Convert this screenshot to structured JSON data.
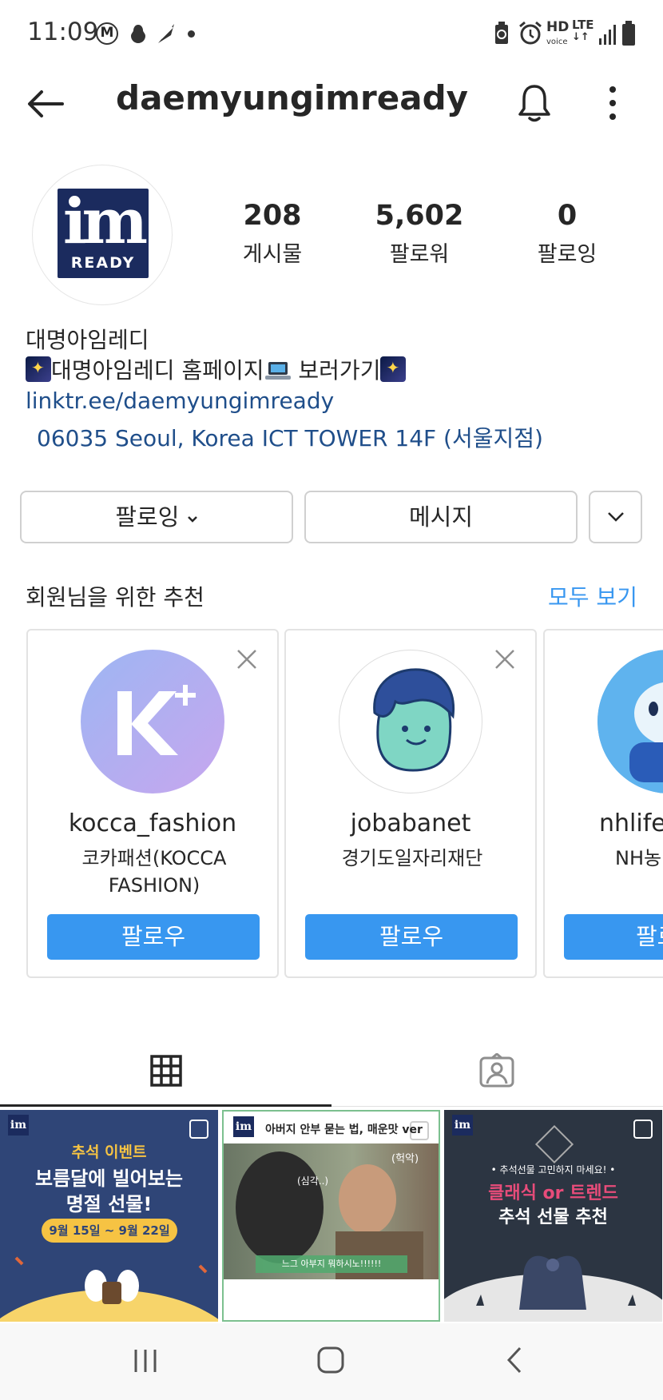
{
  "status_bar": {
    "time": "11:09",
    "hd": "HD",
    "voice": "voice",
    "lte": "LTE"
  },
  "header": {
    "username": "daemyungimready"
  },
  "profile": {
    "logo_text": "im",
    "logo_sub": "READY",
    "stats": [
      {
        "value": "208",
        "label": "게시물"
      },
      {
        "value": "5,602",
        "label": "팔로워"
      },
      {
        "value": "0",
        "label": "팔로잉"
      }
    ],
    "bio": {
      "name": "대명아임레디",
      "line_part1": "대명아임레디 홈페이지",
      "line_part2": " 보러가기",
      "link": "linktr.ee/daemyungimready",
      "address": "06035 Seoul, Korea ICT TOWER 14F (서울지점)"
    }
  },
  "actions": {
    "following_label": "팔로잉",
    "message_label": "메시지"
  },
  "suggestions": {
    "title": "회원님을 위한 추천",
    "see_all": "모두 보기",
    "cards": [
      {
        "username": "kocca_fashion",
        "subtitle": "코카패션(KOCCA FASHION)",
        "follow": "팔로우"
      },
      {
        "username": "jobabanet",
        "subtitle": "경기도일자리재단",
        "follow": "팔로우"
      },
      {
        "username": "nhlife.",
        "subtitle": "NH농",
        "follow": "팔로"
      }
    ]
  },
  "posts": [
    {
      "line1": "추석 이벤트",
      "line2": "보름달에 빌어보는",
      "line3": "명절 선물!",
      "dates": "9월 15일 ~ 9월 22일"
    },
    {
      "headline": "아버지 안부 묻는 법, 매운맛 ver",
      "bubble1": "(헉악)",
      "bubble2": "(심각..)",
      "caption": "느그 아부지 뭐하시노!!!!!!"
    },
    {
      "top": "• 추석선물 고민하지 마세요! •",
      "line1": "클래식 or 트렌드",
      "line2": "추석 선물 추천"
    }
  ],
  "colors": {
    "accent": "#3897f0",
    "link": "#1f4e8a",
    "brand": "#1b2b5e"
  }
}
